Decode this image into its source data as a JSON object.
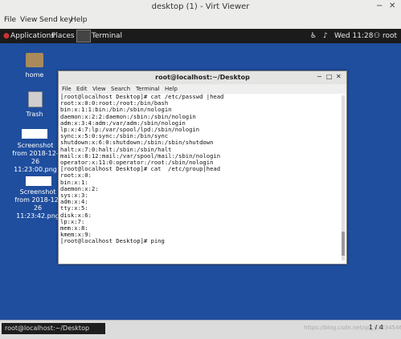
{
  "viewer": {
    "title": "desktop (1) - Virt Viewer",
    "menu": [
      "File",
      "View",
      "Send key",
      "Help"
    ]
  },
  "top_bar": {
    "applications": "Applications",
    "places": "Places",
    "terminal_tab": "Terminal",
    "clock": "Wed 11:28",
    "user": "root"
  },
  "desktop_icons": [
    {
      "label": "home"
    },
    {
      "label": "Trash"
    },
    {
      "label": "Screenshot from 2018-12-26 11:23:00.png"
    },
    {
      "label": "Screenshot from 2018-12-26 11:23:42.png"
    }
  ],
  "terminal": {
    "title": "root@localhost:~/Desktop",
    "menu": [
      "File",
      "Edit",
      "View",
      "Search",
      "Terminal",
      "Help"
    ],
    "lines": [
      "[root@localhost Desktop]# cat /etc/passwd |head",
      "root:x:0:0:root:/root:/bin/bash",
      "bin:x:1:1:bin:/bin:/sbin/nologin",
      "daemon:x:2:2:daemon:/sbin:/sbin/nologin",
      "adm:x:3:4:adm:/var/adm:/sbin/nologin",
      "lp:x:4:7:lp:/var/spool/lpd:/sbin/nologin",
      "sync:x:5:0:sync:/sbin:/bin/sync",
      "shutdown:x:6:0:shutdown:/sbin:/sbin/shutdown",
      "halt:x:7:0:halt:/sbin:/sbin/halt",
      "mail:x:8:12:mail:/var/spool/mail:/sbin/nologin",
      "operator:x:11:0:operator:/root:/sbin/nologin",
      "[root@localhost Desktop]# cat  /etc/group|head",
      "root:x:0:",
      "bin:x:1:",
      "daemon:x:2:",
      "sys:x:3:",
      "adm:x:4:",
      "tty:x:5:",
      "disk:x:6:",
      "lp:x:7:",
      "mem:x:8:",
      "kmem:x:9:",
      "[root@localhost Desktop]# ping"
    ]
  },
  "taskbar": {
    "task": "root@localhost:~/Desktop",
    "page": "1 / 4",
    "watermark": "https://blog.csdn.net/qq_41234546"
  }
}
